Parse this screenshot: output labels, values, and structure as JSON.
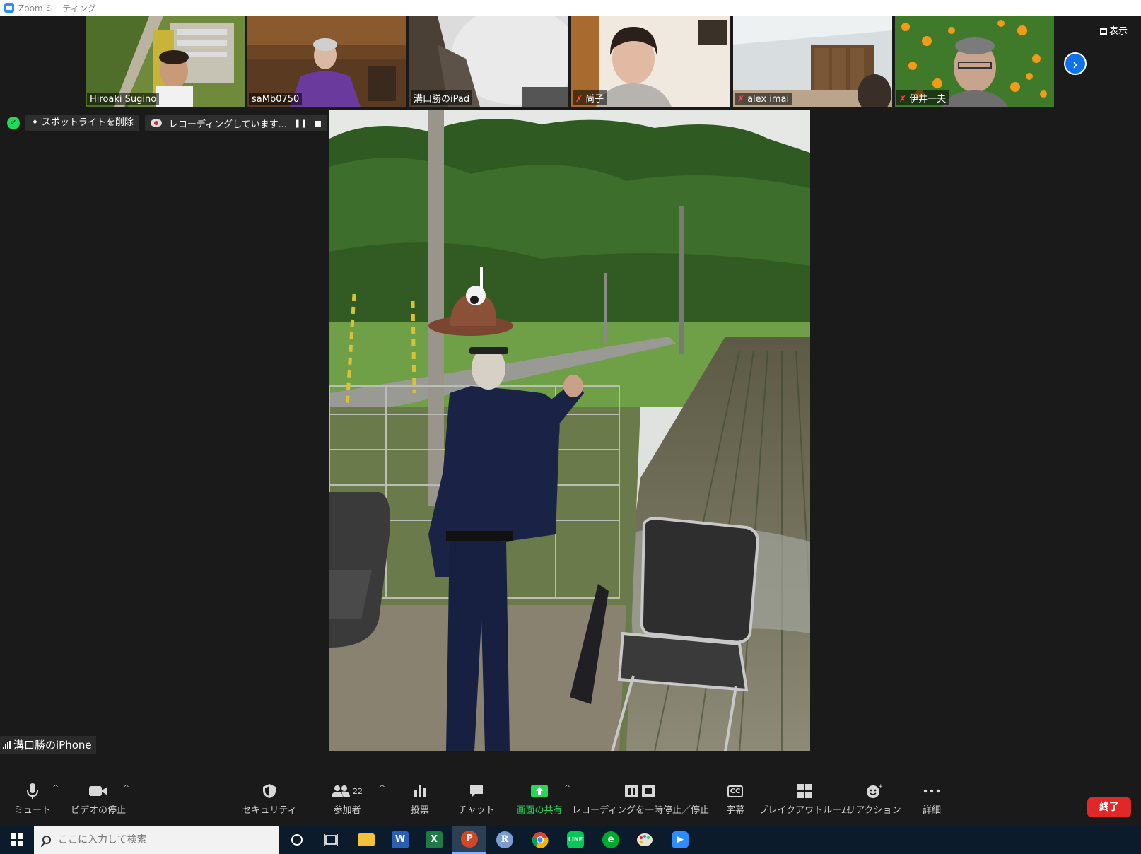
{
  "window": {
    "title": "Zoom ミーティング"
  },
  "gallery": {
    "participants": [
      {
        "name": "Hiroaki Sugino",
        "muted": false
      },
      {
        "name": "saMb0750",
        "muted": false
      },
      {
        "name": "溝口勝のiPad",
        "muted": false
      },
      {
        "name": "尚子",
        "muted": true
      },
      {
        "name": "alex imai",
        "muted": true
      },
      {
        "name": "伊井一夫",
        "muted": true
      }
    ],
    "next_icon": "chevron-right-icon"
  },
  "view_button": {
    "label": "表示"
  },
  "status": {
    "spotlight_label": "スポットライトを削除",
    "recording_label": "レコーディングしています..."
  },
  "speaker": {
    "name": "溝口勝のiPhone"
  },
  "toolbar": {
    "mute": "ミュート",
    "video": "ビデオの停止",
    "security": "セキュリティ",
    "participants": "参加者",
    "participants_count": "22",
    "polls": "投票",
    "chat": "チャット",
    "share": "画面の共有",
    "recording": "レコーディングを一時停止／停止",
    "captions": "字幕",
    "captions_icon_text": "CC",
    "breakout": "ブレイクアウトルーム",
    "reactions": "リアクション",
    "more": "詳細",
    "end": "終了"
  },
  "taskbar": {
    "search_placeholder": "ここに入力して検索",
    "apps": [
      "cortana",
      "task-view",
      "file-explorer",
      "word",
      "excel",
      "powerpoint",
      "r",
      "chrome",
      "line",
      "evernote",
      "paint",
      "zoom"
    ]
  },
  "colors": {
    "accent": "#0e72ed",
    "share_green": "#23d959",
    "end_red": "#e02828",
    "muted_red": "#ff4a4a"
  }
}
